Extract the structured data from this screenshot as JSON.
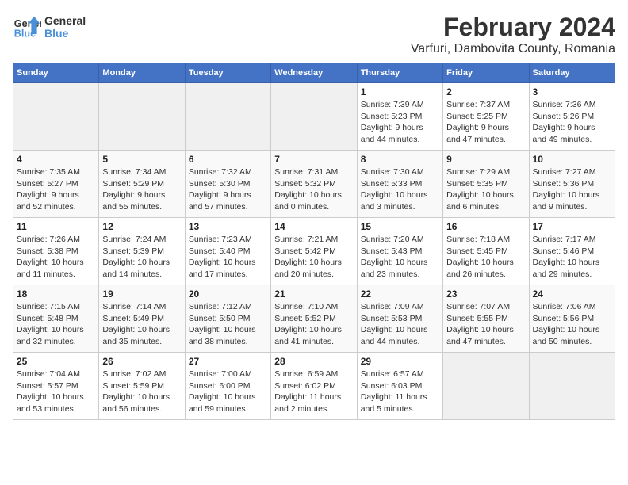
{
  "header": {
    "logo_line1": "General",
    "logo_line2": "Blue",
    "title": "February 2024",
    "subtitle": "Varfuri, Dambovita County, Romania"
  },
  "days_of_week": [
    "Sunday",
    "Monday",
    "Tuesday",
    "Wednesday",
    "Thursday",
    "Friday",
    "Saturday"
  ],
  "weeks": [
    [
      {
        "day": "",
        "detail": ""
      },
      {
        "day": "",
        "detail": ""
      },
      {
        "day": "",
        "detail": ""
      },
      {
        "day": "",
        "detail": ""
      },
      {
        "day": "1",
        "detail": "Sunrise: 7:39 AM\nSunset: 5:23 PM\nDaylight: 9 hours\nand 44 minutes."
      },
      {
        "day": "2",
        "detail": "Sunrise: 7:37 AM\nSunset: 5:25 PM\nDaylight: 9 hours\nand 47 minutes."
      },
      {
        "day": "3",
        "detail": "Sunrise: 7:36 AM\nSunset: 5:26 PM\nDaylight: 9 hours\nand 49 minutes."
      }
    ],
    [
      {
        "day": "4",
        "detail": "Sunrise: 7:35 AM\nSunset: 5:27 PM\nDaylight: 9 hours\nand 52 minutes."
      },
      {
        "day": "5",
        "detail": "Sunrise: 7:34 AM\nSunset: 5:29 PM\nDaylight: 9 hours\nand 55 minutes."
      },
      {
        "day": "6",
        "detail": "Sunrise: 7:32 AM\nSunset: 5:30 PM\nDaylight: 9 hours\nand 57 minutes."
      },
      {
        "day": "7",
        "detail": "Sunrise: 7:31 AM\nSunset: 5:32 PM\nDaylight: 10 hours\nand 0 minutes."
      },
      {
        "day": "8",
        "detail": "Sunrise: 7:30 AM\nSunset: 5:33 PM\nDaylight: 10 hours\nand 3 minutes."
      },
      {
        "day": "9",
        "detail": "Sunrise: 7:29 AM\nSunset: 5:35 PM\nDaylight: 10 hours\nand 6 minutes."
      },
      {
        "day": "10",
        "detail": "Sunrise: 7:27 AM\nSunset: 5:36 PM\nDaylight: 10 hours\nand 9 minutes."
      }
    ],
    [
      {
        "day": "11",
        "detail": "Sunrise: 7:26 AM\nSunset: 5:38 PM\nDaylight: 10 hours\nand 11 minutes."
      },
      {
        "day": "12",
        "detail": "Sunrise: 7:24 AM\nSunset: 5:39 PM\nDaylight: 10 hours\nand 14 minutes."
      },
      {
        "day": "13",
        "detail": "Sunrise: 7:23 AM\nSunset: 5:40 PM\nDaylight: 10 hours\nand 17 minutes."
      },
      {
        "day": "14",
        "detail": "Sunrise: 7:21 AM\nSunset: 5:42 PM\nDaylight: 10 hours\nand 20 minutes."
      },
      {
        "day": "15",
        "detail": "Sunrise: 7:20 AM\nSunset: 5:43 PM\nDaylight: 10 hours\nand 23 minutes."
      },
      {
        "day": "16",
        "detail": "Sunrise: 7:18 AM\nSunset: 5:45 PM\nDaylight: 10 hours\nand 26 minutes."
      },
      {
        "day": "17",
        "detail": "Sunrise: 7:17 AM\nSunset: 5:46 PM\nDaylight: 10 hours\nand 29 minutes."
      }
    ],
    [
      {
        "day": "18",
        "detail": "Sunrise: 7:15 AM\nSunset: 5:48 PM\nDaylight: 10 hours\nand 32 minutes."
      },
      {
        "day": "19",
        "detail": "Sunrise: 7:14 AM\nSunset: 5:49 PM\nDaylight: 10 hours\nand 35 minutes."
      },
      {
        "day": "20",
        "detail": "Sunrise: 7:12 AM\nSunset: 5:50 PM\nDaylight: 10 hours\nand 38 minutes."
      },
      {
        "day": "21",
        "detail": "Sunrise: 7:10 AM\nSunset: 5:52 PM\nDaylight: 10 hours\nand 41 minutes."
      },
      {
        "day": "22",
        "detail": "Sunrise: 7:09 AM\nSunset: 5:53 PM\nDaylight: 10 hours\nand 44 minutes."
      },
      {
        "day": "23",
        "detail": "Sunrise: 7:07 AM\nSunset: 5:55 PM\nDaylight: 10 hours\nand 47 minutes."
      },
      {
        "day": "24",
        "detail": "Sunrise: 7:06 AM\nSunset: 5:56 PM\nDaylight: 10 hours\nand 50 minutes."
      }
    ],
    [
      {
        "day": "25",
        "detail": "Sunrise: 7:04 AM\nSunset: 5:57 PM\nDaylight: 10 hours\nand 53 minutes."
      },
      {
        "day": "26",
        "detail": "Sunrise: 7:02 AM\nSunset: 5:59 PM\nDaylight: 10 hours\nand 56 minutes."
      },
      {
        "day": "27",
        "detail": "Sunrise: 7:00 AM\nSunset: 6:00 PM\nDaylight: 10 hours\nand 59 minutes."
      },
      {
        "day": "28",
        "detail": "Sunrise: 6:59 AM\nSunset: 6:02 PM\nDaylight: 11 hours\nand 2 minutes."
      },
      {
        "day": "29",
        "detail": "Sunrise: 6:57 AM\nSunset: 6:03 PM\nDaylight: 11 hours\nand 5 minutes."
      },
      {
        "day": "",
        "detail": ""
      },
      {
        "day": "",
        "detail": ""
      }
    ]
  ]
}
